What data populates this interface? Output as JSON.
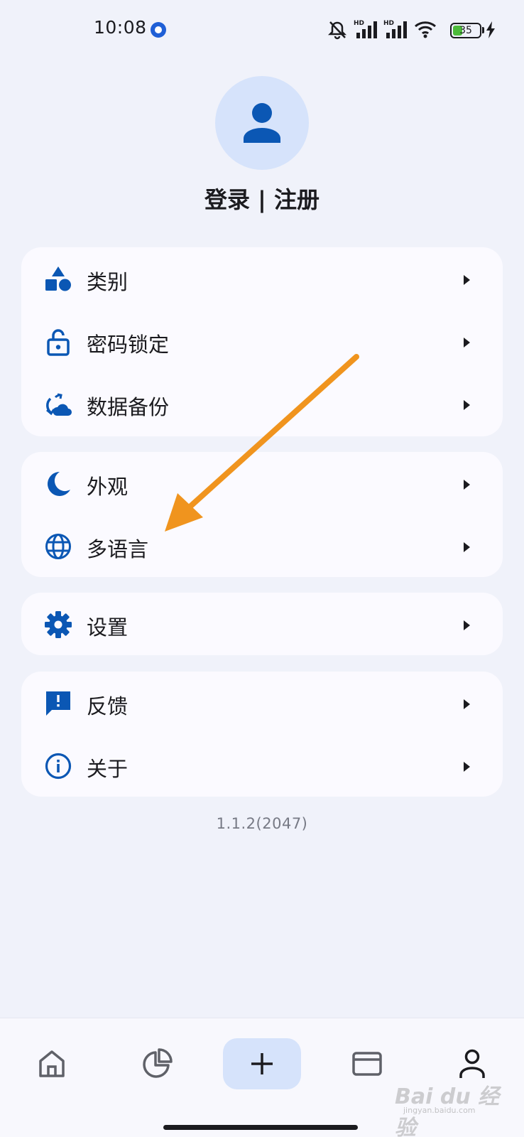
{
  "status_bar": {
    "time": "10:08",
    "hd_label_1": "HD",
    "hd_label_2": "HD",
    "battery_level": "35",
    "battery_fraction": 0.35,
    "icons": [
      "app-notification-icon",
      "mute-icon",
      "signal-icon",
      "signal-icon",
      "wifi-icon",
      "battery-icon",
      "charging-icon"
    ]
  },
  "profile": {
    "login_label": "登录 | 注册"
  },
  "menu_groups": [
    {
      "items": [
        {
          "label": "类别",
          "icon": "category-shapes-icon"
        },
        {
          "label": "密码锁定",
          "icon": "lock-open-icon"
        },
        {
          "label": "数据备份",
          "icon": "cloud-sync-icon"
        }
      ]
    },
    {
      "items": [
        {
          "label": "外观",
          "icon": "moon-icon"
        },
        {
          "label": "多语言",
          "icon": "globe-icon"
        }
      ]
    },
    {
      "items": [
        {
          "label": "设置",
          "icon": "gear-icon"
        }
      ]
    },
    {
      "items": [
        {
          "label": "反馈",
          "icon": "feedback-icon"
        },
        {
          "label": "关于",
          "icon": "info-icon"
        }
      ]
    }
  ],
  "version": "1.1.2(2047)",
  "bottom_nav": {
    "items": [
      "home-icon",
      "pie-chart-icon",
      "plus-icon",
      "card-icon",
      "person-icon"
    ],
    "active": "person-icon"
  },
  "watermark": {
    "text": "Bai du 经验",
    "sub": "jingyan.baidu.com"
  },
  "colors": {
    "accent": "#0b57b4",
    "background": "#f0f2fa",
    "card": "#fbfaff",
    "avatar_bg": "#d6e3fb",
    "annotation": "#f0941e"
  }
}
